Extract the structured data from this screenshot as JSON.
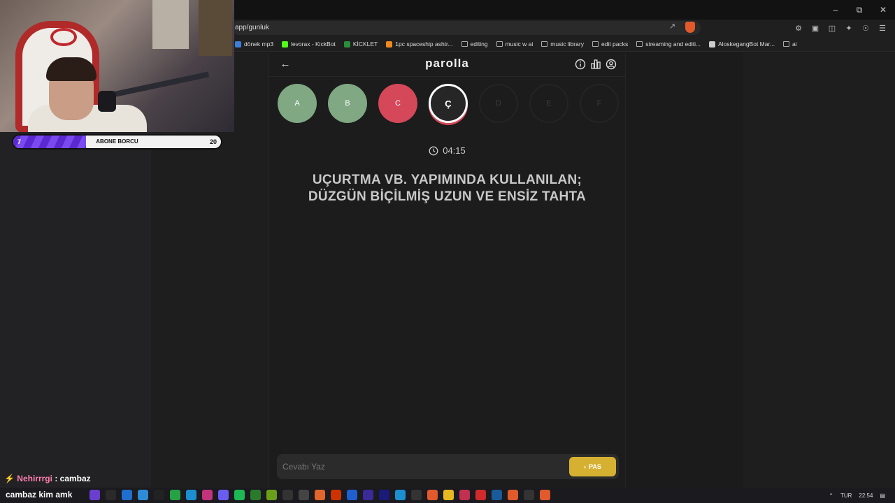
{
  "browser": {
    "url": "app/gunluk",
    "bookmarks": [
      {
        "label": "dönek mp3",
        "color": "#3b7fd8"
      },
      {
        "label": "levorax - KickBot",
        "color": "#53fc18"
      },
      {
        "label": "KİCKLET",
        "color": "#2a8f3a"
      },
      {
        "label": "1pc spaceship ashtr...",
        "color": "#f08a1c"
      },
      {
        "label": "editing",
        "color": ""
      },
      {
        "label": "music w ai",
        "color": ""
      },
      {
        "label": "music library",
        "color": ""
      },
      {
        "label": "edit packs",
        "color": ""
      },
      {
        "label": "streaming and editi...",
        "color": ""
      },
      {
        "label": "AloskegangBot Mar...",
        "color": "#cccccc"
      },
      {
        "label": "ai",
        "color": ""
      }
    ]
  },
  "stream": {
    "sub_goal_current": "7",
    "sub_goal_label": "ABONE BORCU",
    "sub_goal_target": "20",
    "sub_goal_progress": 0.35,
    "chat": [
      {
        "user": "Nehirrrgi",
        "message": ": cambaz"
      },
      {
        "message": "cambaz kim amk"
      }
    ]
  },
  "app": {
    "logo": "parolla",
    "letters": [
      {
        "label": "A",
        "state": "correct"
      },
      {
        "label": "B",
        "state": "correct"
      },
      {
        "label": "C",
        "state": "wrong"
      },
      {
        "label": "Ç",
        "state": "current"
      },
      {
        "label": "D",
        "state": "pending"
      },
      {
        "label": "E",
        "state": "pending"
      },
      {
        "label": "F",
        "state": "pending"
      }
    ],
    "timer": "04:15",
    "question": "UÇURTMA VB. YAPIMINDA KULLANILAN; DÜZGÜN BİÇİLMİŞ UZUN VE ENSİZ TAHTA",
    "answer_placeholder": "Cevabı Yaz",
    "pass_label": "PAS",
    "colors": {
      "correct": "#7fa883",
      "wrong": "#d54859",
      "accent": "#d6b030"
    }
  },
  "taskbar": {
    "language": "TUR",
    "time": "22:54"
  }
}
